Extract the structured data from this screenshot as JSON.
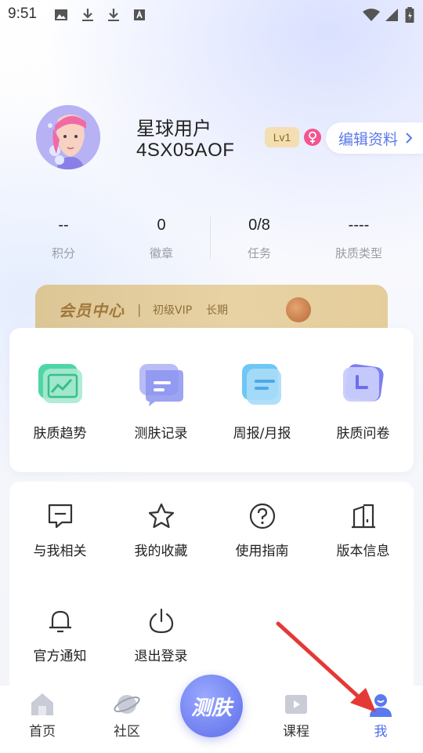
{
  "status_bar": {
    "time": "9:51"
  },
  "profile": {
    "name": "星球用户",
    "user_id": "4SX05AOF",
    "level": "Lv1",
    "edit_label": "编辑资料"
  },
  "stats": [
    {
      "value": "--",
      "label": "积分"
    },
    {
      "value": "0",
      "label": "徽章"
    },
    {
      "value": "0/8",
      "label": "任务"
    },
    {
      "value": "----",
      "label": "肤质类型"
    }
  ],
  "vip": {
    "title": "会员中心",
    "separator": "|",
    "tier": "初级VIP",
    "duration": "长期"
  },
  "tools": [
    {
      "label": "肤质趋势",
      "icon": "chart-trend-icon"
    },
    {
      "label": "测肤记录",
      "icon": "chat-record-icon"
    },
    {
      "label": "周报/月报",
      "icon": "report-icon"
    },
    {
      "label": "肤质问卷",
      "icon": "clock-questionnaire-icon"
    }
  ],
  "menu": [
    {
      "label": "与我相关",
      "icon": "message-icon"
    },
    {
      "label": "我的收藏",
      "icon": "star-icon"
    },
    {
      "label": "使用指南",
      "icon": "help-icon"
    },
    {
      "label": "版本信息",
      "icon": "building-icon"
    },
    {
      "label": "官方通知",
      "icon": "bell-icon"
    },
    {
      "label": "退出登录",
      "icon": "power-icon"
    }
  ],
  "nav": {
    "items": [
      {
        "label": "首页",
        "icon": "home-icon"
      },
      {
        "label": "社区",
        "icon": "planet-icon"
      },
      {
        "label": "课程",
        "icon": "video-icon"
      },
      {
        "label": "我",
        "icon": "user-icon"
      }
    ],
    "center_label": "测肤",
    "active": "我"
  },
  "colors": {
    "accent": "#4f6ee8",
    "vip_gold": "#dcc696",
    "annotation_arrow": "#e53935"
  }
}
